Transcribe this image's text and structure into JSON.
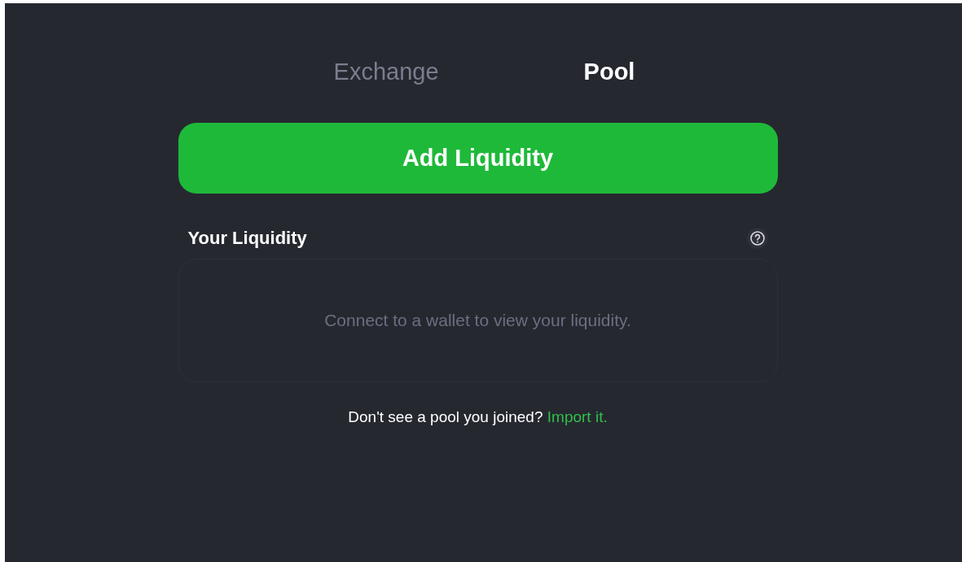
{
  "tabs": [
    {
      "label": "Exchange",
      "selected": false
    },
    {
      "label": "Pool",
      "selected": true
    }
  ],
  "primary_button": {
    "label": "Add Liquidity"
  },
  "liquidity": {
    "title": "Your Liquidity",
    "empty_message": "Connect to a wallet to view your liquidity."
  },
  "footer": {
    "prompt": "Don't see a pool you joined?",
    "link": "Import it."
  }
}
